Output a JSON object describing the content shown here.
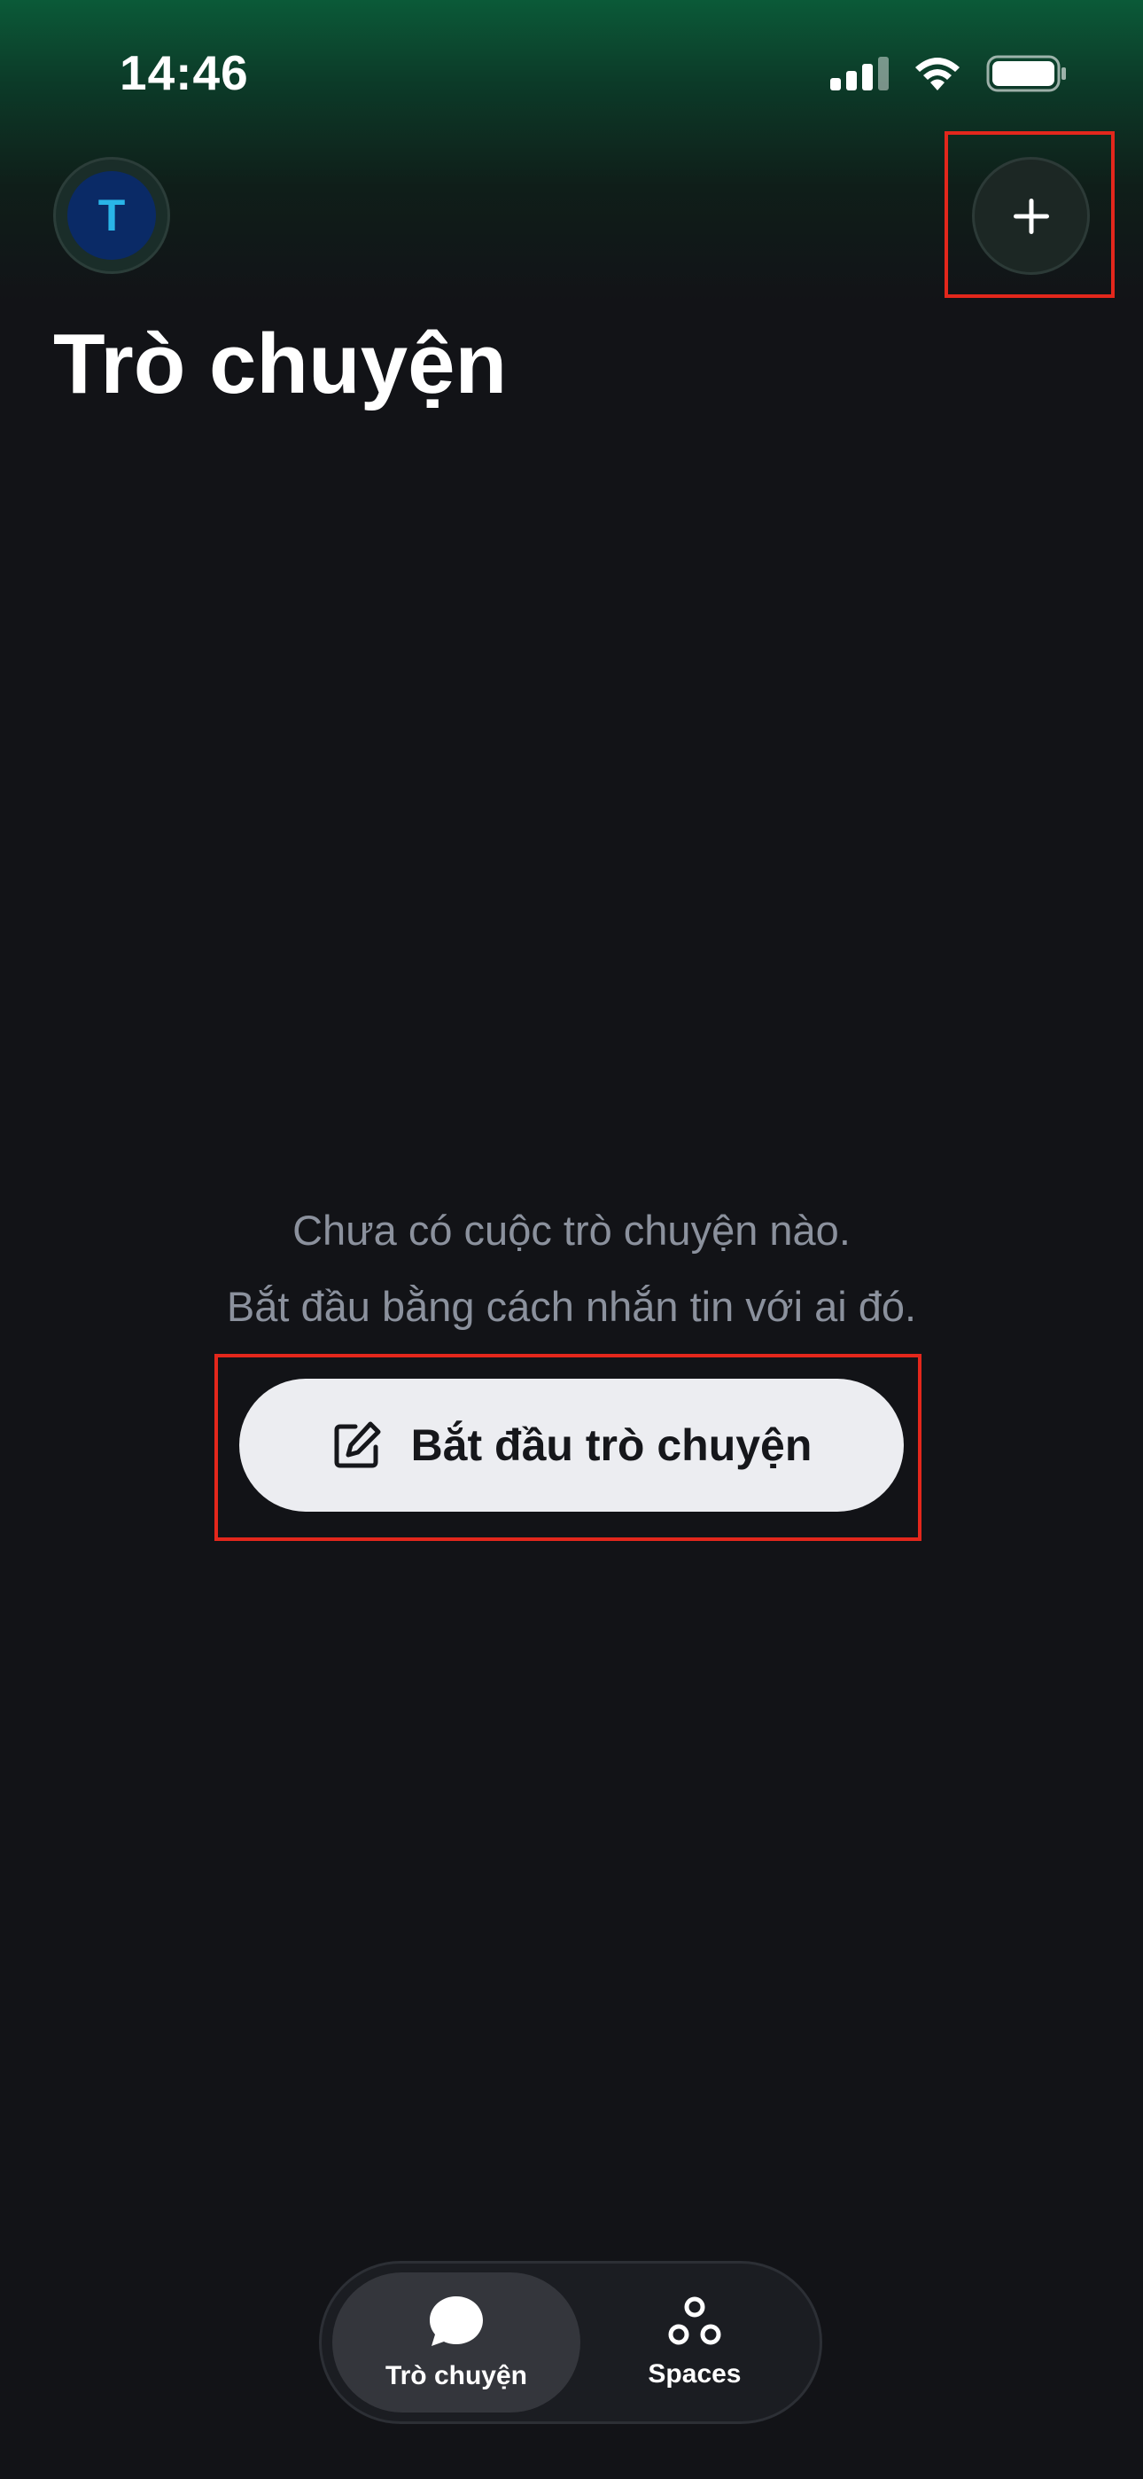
{
  "status_bar": {
    "time": "14:46",
    "icons": [
      "cellular-signal-icon",
      "wifi-icon",
      "battery-icon"
    ]
  },
  "header": {
    "avatar_initial": "T",
    "compose_icon": "plus-icon"
  },
  "page": {
    "title": "Trò chuyện"
  },
  "empty_state": {
    "line1": "Chưa có cuộc trò chuyện nào.",
    "line2": "Bắt đầu bằng cách nhắn tin với ai đó.",
    "start_button_label": "Bắt đầu trò chuyện",
    "start_button_icon": "edit-icon"
  },
  "tab_bar": {
    "tabs": [
      {
        "label": "Trò chuyện",
        "icon": "chat-bubble-icon",
        "selected": true
      },
      {
        "label": "Spaces",
        "icon": "spaces-icon",
        "selected": false
      }
    ]
  },
  "colors": {
    "background": "#121317",
    "top_gradient": "#0b5a38",
    "avatar_bg": "#0a2a66",
    "avatar_text": "#29b5e8",
    "button_bg": "#ecedf1",
    "muted_text": "#8b919d",
    "highlight": "#e3271c"
  }
}
